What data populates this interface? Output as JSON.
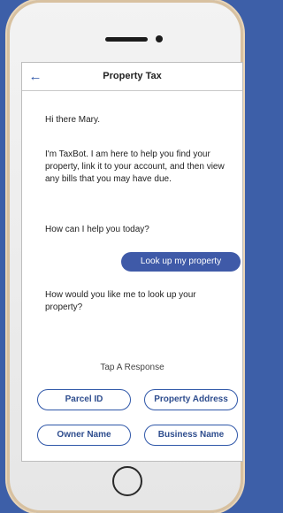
{
  "header": {
    "title": "Property Tax",
    "back_icon": "arrow-left-icon"
  },
  "chat": {
    "greeting": "Hi there Mary.",
    "intro": "I'm TaxBot. I am here to help you find your property, link it to your account, and then view any bills that you may have due.",
    "question": "How can I help you today?",
    "user_reply": "Look up my property",
    "followup": "How would you like me to look up your property?"
  },
  "responses": {
    "prompt": "Tap A Response",
    "options": [
      "Parcel ID",
      "Property Address",
      "Owner Name",
      "Business Name"
    ]
  },
  "colors": {
    "accent": "#2e56a8",
    "bubble": "#3f5aa8",
    "background": "#3d5fa8"
  }
}
